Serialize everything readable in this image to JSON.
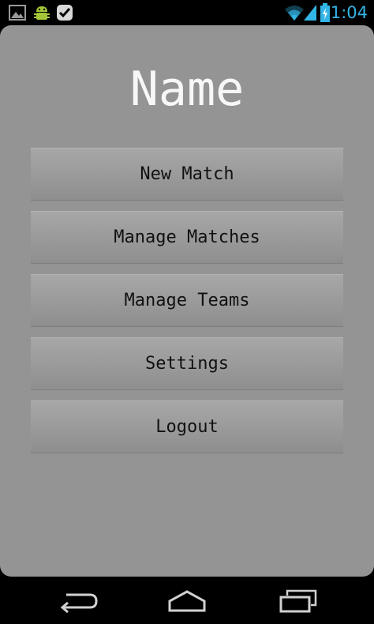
{
  "status_bar": {
    "time": "1:04",
    "colors": {
      "accent": "#33b5e5",
      "android_green": "#a4c639"
    },
    "icons": [
      "gallery-icon",
      "android-debug-icon",
      "task-check-icon",
      "wifi-icon",
      "signal-icon",
      "battery-charging-icon"
    ]
  },
  "app": {
    "title": "Name",
    "background": "#949494",
    "buttons": [
      {
        "label": "New Match"
      },
      {
        "label": "Manage Matches"
      },
      {
        "label": "Manage Teams"
      },
      {
        "label": "Settings"
      },
      {
        "label": "Logout"
      }
    ]
  },
  "nav_bar": {
    "icons": [
      "back-icon",
      "home-icon",
      "recent-apps-icon"
    ]
  }
}
